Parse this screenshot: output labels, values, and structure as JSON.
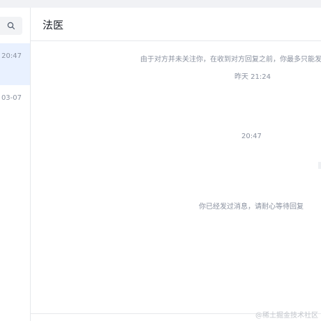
{
  "sidebar": {
    "search_icon": "search-icon",
    "conversations": [
      {
        "time": "20:47",
        "active": true
      },
      {
        "time": "03-07",
        "active": false
      }
    ]
  },
  "chat": {
    "title": "法医",
    "messages": [
      {
        "kind": "system-notice",
        "text": "由于对方并未关注你，在收到对方回复之前，你最多只能发送"
      },
      {
        "kind": "timestamp",
        "text": "昨天 21:24"
      },
      {
        "kind": "timestamp",
        "text": "20:47"
      },
      {
        "kind": "system-notice",
        "text": "你已经发过消息，请耐心等待回复"
      }
    ]
  },
  "watermark": "@稀土掘金技术社区",
  "colors": {
    "active_row": "#e9f1ff",
    "muted_text": "#8a919f",
    "title_text": "#1d2129"
  }
}
